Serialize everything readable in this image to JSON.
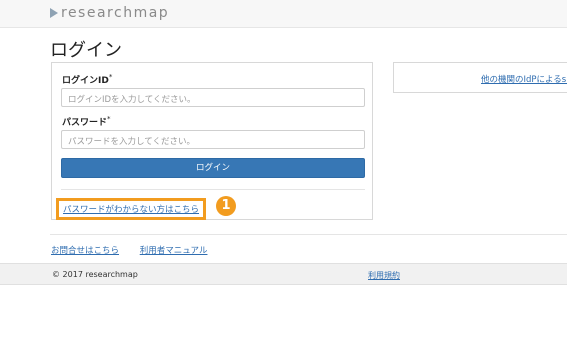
{
  "header": {
    "logo_text": "researchmap"
  },
  "page": {
    "title": "ログイン"
  },
  "login_form": {
    "id_label": "ログインID",
    "id_placeholder": "ログインIDを入力してください。",
    "password_label": "パスワード",
    "password_placeholder": "パスワードを入力してください。",
    "required_mark": "*",
    "login_button": "ログイン",
    "forgot_password_link": "パスワードがわからない方はこちら",
    "step_badge": "1",
    "highlight_color": "#f29c1f"
  },
  "idp": {
    "link": "他の機関のIdPによるsh"
  },
  "bottom_links": {
    "contact": "お問合せはこちら",
    "manual": "利用者マニュアル"
  },
  "footer": {
    "copyright": "2017 researchmap",
    "terms": "利用規約"
  },
  "colors": {
    "primary": "#3777b5",
    "link": "#2f6db0",
    "accent": "#f29c1f"
  }
}
